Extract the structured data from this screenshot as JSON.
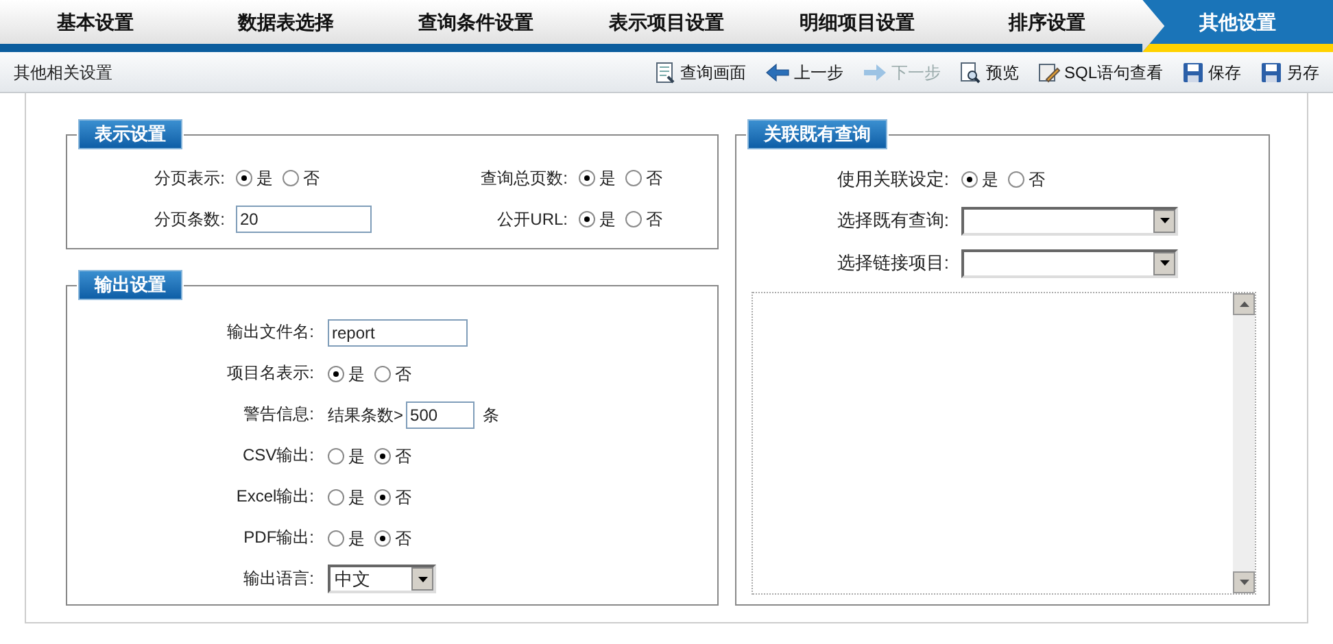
{
  "tabs": [
    {
      "label": "基本设置",
      "selected": false
    },
    {
      "label": "数据表选择",
      "selected": false
    },
    {
      "label": "查询条件设置",
      "selected": false
    },
    {
      "label": "表示项目设置",
      "selected": false
    },
    {
      "label": "明细项目设置",
      "selected": false
    },
    {
      "label": "排序设置",
      "selected": false
    },
    {
      "label": "其他设置",
      "selected": true
    }
  ],
  "subtitle": "其他相关设置",
  "toolbar": [
    {
      "kind": "query",
      "label": "查询画面",
      "disabled": false
    },
    {
      "kind": "back",
      "label": "上一步",
      "disabled": false
    },
    {
      "kind": "next",
      "label": "下一步",
      "disabled": true
    },
    {
      "kind": "preview",
      "label": "预览",
      "disabled": false
    },
    {
      "kind": "sql",
      "label": "SQL语句查看",
      "disabled": false
    },
    {
      "kind": "save",
      "label": "保存",
      "disabled": false
    },
    {
      "kind": "save",
      "label": "另存",
      "disabled": false
    }
  ],
  "display_settings": {
    "title": "表示设置",
    "fields": [
      {
        "kind": "radio",
        "label": "分页表示:",
        "options": [
          {
            "label": "是",
            "selected": true
          },
          {
            "label": "否",
            "selected": false
          }
        ]
      },
      {
        "kind": "radio",
        "label": "查询总页数:",
        "options": [
          {
            "label": "是",
            "selected": true
          },
          {
            "label": "否",
            "selected": false
          }
        ]
      },
      {
        "kind": "text",
        "label": "分页条数:",
        "value": "20"
      },
      {
        "kind": "radio",
        "label": "公开URL:",
        "options": [
          {
            "label": "是",
            "selected": true
          },
          {
            "label": "否",
            "selected": false
          }
        ]
      }
    ]
  },
  "output_settings": {
    "title": "输出设置",
    "fields": [
      {
        "kind": "text",
        "label": "输出文件名:",
        "value": "report"
      },
      {
        "kind": "radio",
        "label": "项目名表示:",
        "options": [
          {
            "label": "是",
            "selected": true
          },
          {
            "label": "否",
            "selected": false
          }
        ]
      },
      {
        "kind": "warning",
        "label": "警告信息:",
        "prefix": "结果条数>",
        "value": "500",
        "suffix": "条"
      },
      {
        "kind": "radio",
        "label": "CSV输出:",
        "options": [
          {
            "label": "是",
            "selected": false
          },
          {
            "label": "否",
            "selected": true
          }
        ]
      },
      {
        "kind": "radio",
        "label": "Excel输出:",
        "options": [
          {
            "label": "是",
            "selected": false
          },
          {
            "label": "否",
            "selected": true
          }
        ]
      },
      {
        "kind": "radio",
        "label": "PDF输出:",
        "options": [
          {
            "label": "是",
            "selected": false
          },
          {
            "label": "否",
            "selected": true
          }
        ]
      },
      {
        "kind": "select",
        "label": "输出语言:",
        "value": "中文"
      }
    ]
  },
  "linked_query": {
    "title": "关联既有查询",
    "fields": [
      {
        "kind": "radio",
        "label": "使用关联设定:",
        "options": [
          {
            "label": "是",
            "selected": true
          },
          {
            "label": "否",
            "selected": false
          }
        ]
      },
      {
        "kind": "select",
        "label": "选择既有查询:"
      },
      {
        "kind": "select",
        "label": "选择链接项目:"
      }
    ]
  }
}
